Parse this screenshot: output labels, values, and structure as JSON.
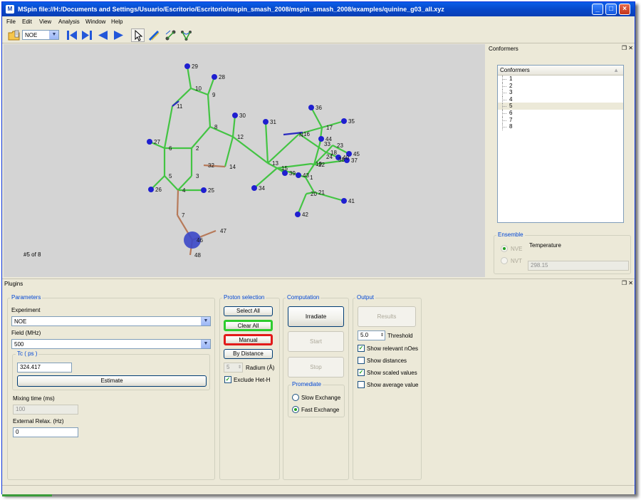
{
  "window": {
    "title": "MSpin file://H:/Documents and Settings/Usuario/Escritorio/Escritorio/mspin_smash_2008/mspin_smash_2008/examples/quinine_g03_all.xyz"
  },
  "menu": [
    "File",
    "Edit",
    "View",
    "Analysis",
    "Window",
    "Help"
  ],
  "toolbar": {
    "mode_value": "NOE"
  },
  "viewer": {
    "status": "#5 of 8"
  },
  "molecule": {
    "atoms": [
      {
        "label": "29"
      },
      {
        "label": "28"
      },
      {
        "label": "10"
      },
      {
        "label": "9"
      },
      {
        "label": "11"
      },
      {
        "label": "8"
      },
      {
        "label": "30"
      },
      {
        "label": "31"
      },
      {
        "label": "12"
      },
      {
        "label": "27"
      },
      {
        "label": "6"
      },
      {
        "label": "2"
      },
      {
        "label": "32"
      },
      {
        "label": "14"
      },
      {
        "label": "13"
      },
      {
        "label": "15"
      },
      {
        "label": "5"
      },
      {
        "label": "3"
      },
      {
        "label": "26"
      },
      {
        "label": "4"
      },
      {
        "label": "25"
      },
      {
        "label": "34"
      },
      {
        "label": "39"
      },
      {
        "label": "7"
      },
      {
        "label": "47"
      },
      {
        "label": "48"
      },
      {
        "label": "36"
      },
      {
        "label": "35"
      },
      {
        "label": "17"
      },
      {
        "label": "16"
      },
      {
        "label": "N"
      },
      {
        "label": "44"
      },
      {
        "label": "18"
      },
      {
        "label": "23"
      },
      {
        "label": "40"
      },
      {
        "label": "45"
      },
      {
        "label": "37"
      },
      {
        "label": "1"
      },
      {
        "label": "21"
      },
      {
        "label": "41"
      },
      {
        "label": "42"
      },
      {
        "label": "20"
      },
      {
        "label": "33"
      },
      {
        "label": "22"
      },
      {
        "label": "38"
      },
      {
        "label": "24"
      },
      {
        "label": "19"
      },
      {
        "label": "46"
      },
      {
        "label": "43"
      }
    ]
  },
  "conformers_panel": {
    "title": "Conformers",
    "list_header": "Conformers",
    "items": [
      "1",
      "2",
      "3",
      "4",
      "5",
      "6",
      "7",
      "8"
    ],
    "selected": "5",
    "ensemble": {
      "title": "Ensemble",
      "options": [
        "NVE",
        "NVT"
      ],
      "temperature_label": "Temperature",
      "temperature_value": "298.15"
    }
  },
  "plugins": {
    "title": "Plugins",
    "parameters": {
      "title": "Parameters",
      "experiment_label": "Experiment",
      "experiment_value": "NOE",
      "field_label": "Field (MHz)",
      "field_value": "500",
      "tc_title": "Tc ( ps )",
      "tc_value": "324.417",
      "estimate_label": "Estimate",
      "mixing_label": "Mixing time (ms)",
      "mixing_value": "100",
      "external_label": "External Relax. (Hz)",
      "external_value": "0"
    },
    "proton_selection": {
      "title": "Proton selection",
      "select_all": "Select All",
      "clear_all": "Clear All",
      "manual": "Manual",
      "by_distance": "By Distance",
      "radius_value": "5",
      "radius_label": "Radium (Å)",
      "exclude_label": "Exclude Het-H",
      "exclude_checked": true,
      "clear_all_highlight": "#2ecc2e",
      "manual_highlight": "#e21a1a"
    },
    "computation": {
      "title": "Computation",
      "irradiate": "Irradiate",
      "start": "Start",
      "stop": "Stop",
      "promediate_title": "Promediate",
      "slow": "Slow Exchange",
      "fast": "Fast Exchange",
      "selected": "Fast Exchange"
    },
    "output": {
      "title": "Output",
      "results": "Results",
      "threshold_value": "5.0",
      "threshold_label": "Threshold",
      "options": [
        {
          "label": "Show relevant nOes",
          "checked": true
        },
        {
          "label": "Show distances",
          "checked": false
        },
        {
          "label": "Show scaled values",
          "checked": true
        },
        {
          "label": "Show average value",
          "checked": false
        }
      ]
    }
  },
  "colors": {
    "accent": "#0a4ad0",
    "bond": "#43c443",
    "atom": "#1f1fd0",
    "oxygen_bond": "#b77a5a",
    "viewer_bg": "#d4d4d4"
  }
}
